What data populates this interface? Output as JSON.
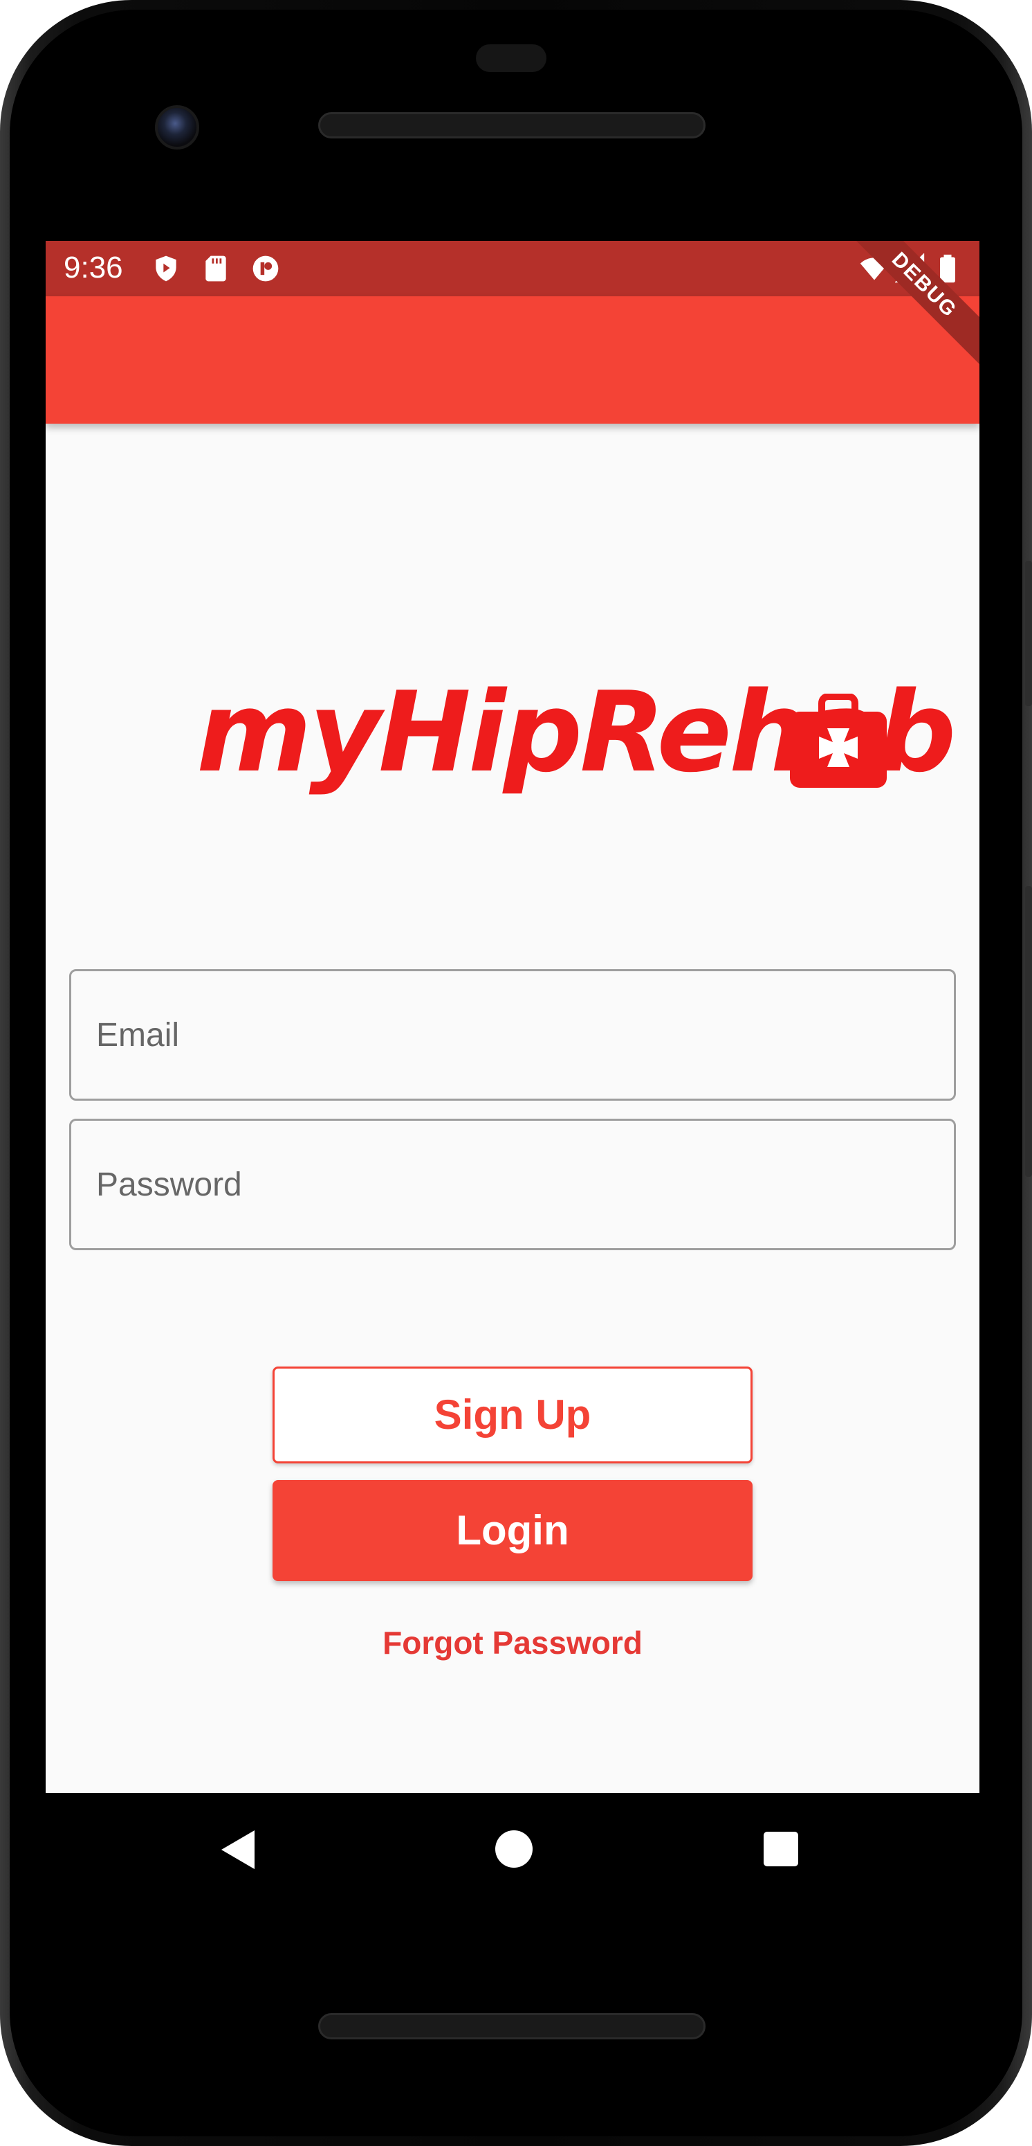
{
  "status_bar": {
    "time": "9:36",
    "left_icons": [
      "shield-play-icon",
      "sd-card-icon",
      "circle-app-icon"
    ],
    "right_icons": [
      "wifi-icon",
      "signal-icon",
      "battery-icon"
    ],
    "color": "#b5302a"
  },
  "app_bar": {
    "color": "#f44336",
    "debug_banner": "DEBUG"
  },
  "logo": {
    "text": "myHipRehab",
    "icon": "first-aid-kit-icon",
    "color": "#ee1c1c"
  },
  "form": {
    "email_placeholder": "Email",
    "email_value": "",
    "password_placeholder": "Password",
    "password_value": ""
  },
  "buttons": {
    "signup_label": "Sign Up",
    "login_label": "Login",
    "forgot_label": "Forgot Password"
  },
  "nav_bar": {
    "icons": [
      "back-icon",
      "home-icon",
      "recents-icon"
    ]
  },
  "colors": {
    "accent": "#f44336",
    "background": "#fafafa"
  }
}
